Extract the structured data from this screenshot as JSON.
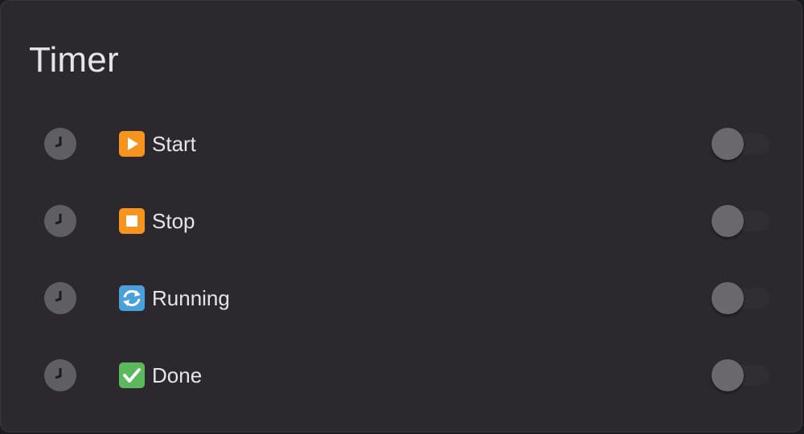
{
  "card": {
    "title": "Timer"
  },
  "rows": [
    {
      "icon": "clock-icon",
      "emoji": "play-button-icon",
      "label": "Start",
      "toggle_on": false
    },
    {
      "icon": "clock-icon",
      "emoji": "stop-button-icon",
      "label": "Stop",
      "toggle_on": false
    },
    {
      "icon": "clock-icon",
      "emoji": "repeat-arrows-icon",
      "label": "Running",
      "toggle_on": false
    },
    {
      "icon": "clock-icon",
      "emoji": "check-mark-icon",
      "label": "Done",
      "toggle_on": false
    }
  ],
  "colors": {
    "background": "#2b292e",
    "text": "#e6e4e8",
    "icon_circle": "#5f5e62",
    "toggle_thumb": "#6a686c",
    "emoji_orange": "#f7941d",
    "emoji_blue": "#4aa0d8",
    "emoji_green": "#5cb85c"
  }
}
